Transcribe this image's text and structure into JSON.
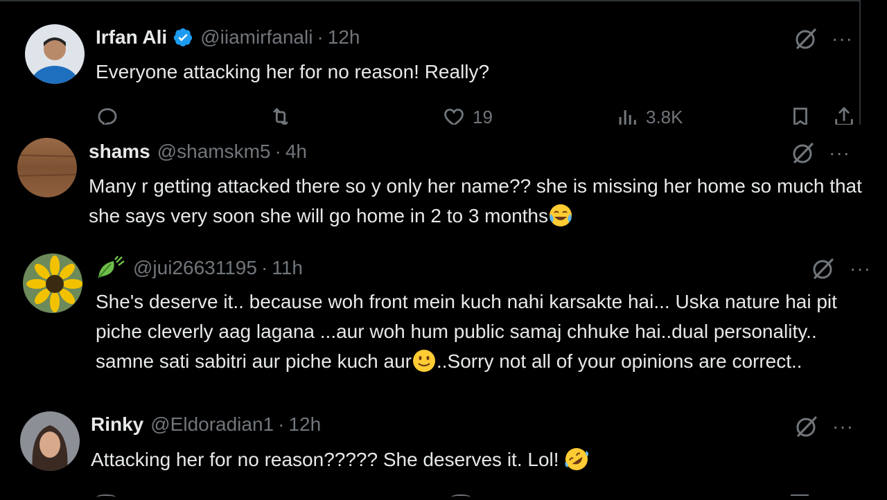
{
  "tweets": [
    {
      "name": "Irfan Ali",
      "handle": "@iiamirfanali",
      "separator": "·",
      "time": "12h",
      "text": "Everyone attacking her for no reason! Really?",
      "verified": true,
      "avatar_color": "#2a6fb0",
      "actions": {
        "likes": "19",
        "views": "3.8K"
      }
    },
    {
      "name": "shams",
      "handle": "@shamskm5",
      "separator": "·",
      "time": "4h",
      "text": "Many r getting attacked there so y only her name?? she is missing her home so much that she says very soon she will go home in 2 to 3 months",
      "emoji": "face-with-tears-of-joy",
      "avatar_color": "#8a5a3a"
    },
    {
      "name": "🍃",
      "handle": "@jui26631195",
      "separator": "·",
      "time": "11h",
      "text_part1": "She's deserve it.. because woh front mein kuch nahi karsakte hai...  Uska nature hai pit piche cleverly aag lagana ...aur woh hum public samaj chhuke hai..dual personality.. samne sati sabitri aur piche kuch aur",
      "text_part2": "..Sorry not all of your opinions are correct..",
      "emoji": "slightly-smiling-face",
      "avatar_color": "#e8b400"
    },
    {
      "name": "Rinky",
      "handle": "@Eldoradian1",
      "separator": "·",
      "time": "12h",
      "text": "Attacking her for no reason????? She deserves it. Lol!",
      "emoji": "rolling-on-floor-laughing",
      "avatar_color": "#6b4c3c"
    }
  ],
  "icons": {
    "grok": "grok-icon",
    "more": "more-icon",
    "reply": "reply-icon",
    "retweet": "retweet-icon",
    "like": "like-icon",
    "views": "views-icon",
    "bookmark": "bookmark-icon",
    "share": "share-icon"
  },
  "ui": {
    "more_glyph": "···"
  },
  "colors": {
    "background": "#000000",
    "text": "#e7e9ea",
    "secondary": "#71767b",
    "verified": "#1d9bf0",
    "border": "#2f3336"
  }
}
